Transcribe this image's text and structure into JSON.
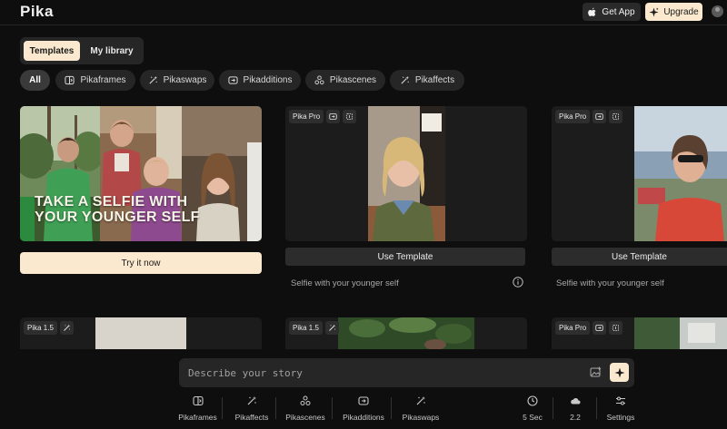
{
  "header": {
    "logo": "Pika",
    "get_app_label": "Get App",
    "upgrade_label": "Upgrade"
  },
  "main_tabs": [
    {
      "label": "Templates",
      "active": true
    },
    {
      "label": "My library",
      "active": false
    }
  ],
  "filters": [
    {
      "label": "All",
      "icon": "none",
      "active": true
    },
    {
      "label": "Pikaframes",
      "icon": "frames-icon"
    },
    {
      "label": "Pikaswaps",
      "icon": "swap-wand-icon"
    },
    {
      "label": "Pikadditions",
      "icon": "additions-icon"
    },
    {
      "label": "Pikascenes",
      "icon": "scenes-icon"
    },
    {
      "label": "Pikaffects",
      "icon": "effects-wand-icon"
    }
  ],
  "hero": {
    "line1": "TAKE A SELFIE WITH",
    "line2": "YOUR YOUNGER SELF",
    "button_label": "Try it now"
  },
  "cards": [
    {
      "badge": "Pika Pro",
      "button_label": "Use Template",
      "caption": "Selfie with your younger self"
    },
    {
      "badge": "Pika Pro",
      "button_label": "Use Template",
      "caption": "Selfie with your younger self"
    }
  ],
  "row2": [
    {
      "badge": "Pika 1.5"
    },
    {
      "badge": "Pika 1.5"
    },
    {
      "badge": "Pika Pro"
    }
  ],
  "prompt": {
    "placeholder": "Describe your story"
  },
  "toolbar": [
    {
      "label": "Pikaframes",
      "icon": "frames-icon"
    },
    {
      "label": "Pikaffects",
      "icon": "effects-wand-icon"
    },
    {
      "label": "Pikascenes",
      "icon": "scenes-icon"
    },
    {
      "label": "Pikadditions",
      "icon": "additions-icon"
    },
    {
      "label": "Pikaswaps",
      "icon": "swap-wand-icon"
    }
  ],
  "settings_bar": [
    {
      "label": "5 Sec",
      "icon": "clock-icon"
    },
    {
      "label": "2.2",
      "icon": "cloud-icon"
    },
    {
      "label": "Settings",
      "icon": "sliders-icon"
    }
  ],
  "colors": {
    "accent": "#fbe9cf",
    "background": "#0e0e0e",
    "surface": "#262626"
  }
}
